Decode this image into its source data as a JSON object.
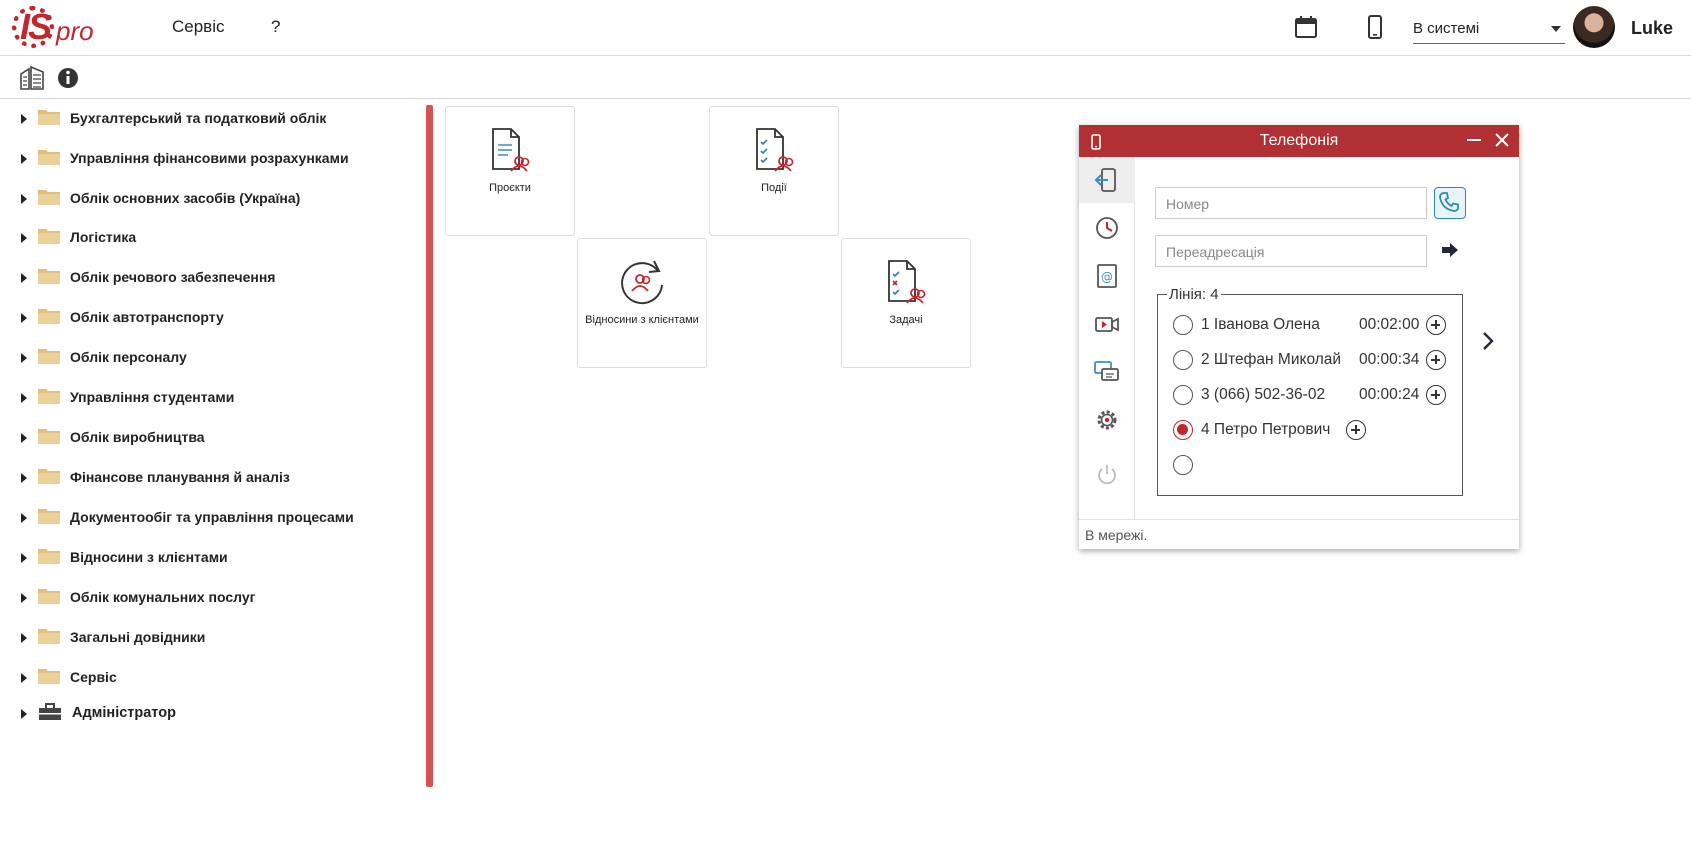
{
  "app": {
    "logo_main": "IS",
    "logo_sub": "pro"
  },
  "topbar": {
    "menu": [
      "Сервіс",
      "?"
    ],
    "status": "В системі",
    "username": "Luke"
  },
  "tree": {
    "items": [
      {
        "label": "Бухгалтерський та податковий облік"
      },
      {
        "label": "Управління фінансовими розрахунками"
      },
      {
        "label": "Облік основних засобів (Україна)"
      },
      {
        "label": "Логістика"
      },
      {
        "label": "Облік речового забезпечення"
      },
      {
        "label": "Облік автотранспорту"
      },
      {
        "label": "Облік персоналу"
      },
      {
        "label": "Управління студентами"
      },
      {
        "label": "Облік виробництва"
      },
      {
        "label": "Фінансове планування й аналіз"
      },
      {
        "label": "Документообіг та управління процесами"
      },
      {
        "label": "Відносини з клієнтами"
      },
      {
        "label": "Облік комунальних послуг"
      },
      {
        "label": "Загальні довідники"
      },
      {
        "label": "Сервіс"
      },
      {
        "label": "Адміністратор"
      }
    ]
  },
  "tiles": [
    {
      "label": "Проєкти"
    },
    {
      "label": "Події"
    },
    {
      "label": "Відносини з клієнтами"
    },
    {
      "label": "Задачі"
    }
  ],
  "telephony": {
    "title": "Телефонія",
    "number_placeholder": "Номер",
    "forward_placeholder": "Переадресація",
    "lines_legend": "Лінія: 4",
    "lines": [
      {
        "text": "1 Іванова Олена",
        "time": "00:02:00",
        "selected": false
      },
      {
        "text": "2 Штефан Миколай",
        "time": "00:00:34",
        "selected": false
      },
      {
        "text": "3 (066) 502-36-02",
        "time": "00:00:24",
        "selected": false
      },
      {
        "text": "4 Петро Петрович",
        "time": "",
        "selected": true
      },
      {
        "text": "",
        "time": "",
        "selected": false
      }
    ],
    "status": "В мережі.",
    "accent": "#b03034"
  }
}
